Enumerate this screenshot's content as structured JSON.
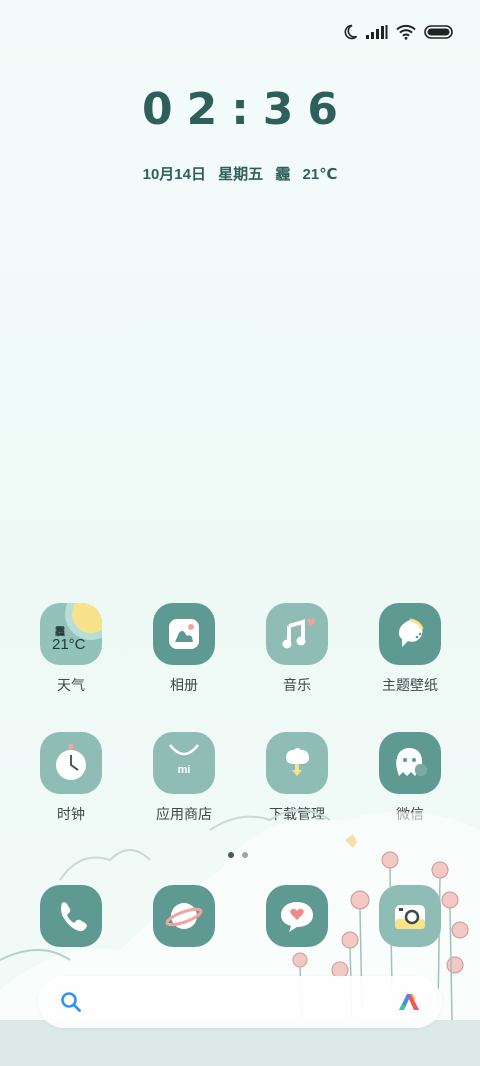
{
  "status_bar": {
    "icons": [
      "moon-icon",
      "signal-icon",
      "wifi-icon",
      "battery-icon"
    ]
  },
  "clock": {
    "time": "02:36"
  },
  "date": {
    "day": "10月14日",
    "weekday": "星期五",
    "weather": "霾",
    "temp": "21℃"
  },
  "weather_widget": {
    "condition": "霾",
    "temp": "21°C"
  },
  "apps_row1": [
    {
      "label": "天气",
      "icon": "weather-icon"
    },
    {
      "label": "相册",
      "icon": "gallery-icon"
    },
    {
      "label": "音乐",
      "icon": "music-icon"
    },
    {
      "label": "主题壁纸",
      "icon": "themes-icon"
    }
  ],
  "apps_row2": [
    {
      "label": "时钟",
      "icon": "clock-icon"
    },
    {
      "label": "应用商店",
      "icon": "app-store-icon"
    },
    {
      "label": "下载管理",
      "icon": "download-icon"
    },
    {
      "label": "微信",
      "icon": "wechat-icon"
    }
  ],
  "dock": [
    {
      "icon": "phone-icon"
    },
    {
      "icon": "browser-icon"
    },
    {
      "icon": "messages-icon"
    },
    {
      "icon": "camera-icon"
    }
  ],
  "pages": {
    "count": 2,
    "current": 1
  },
  "colors": {
    "icon_dark": "#5f9a92",
    "icon_light": "#8fbcb5",
    "text": "#2e5f5a"
  }
}
